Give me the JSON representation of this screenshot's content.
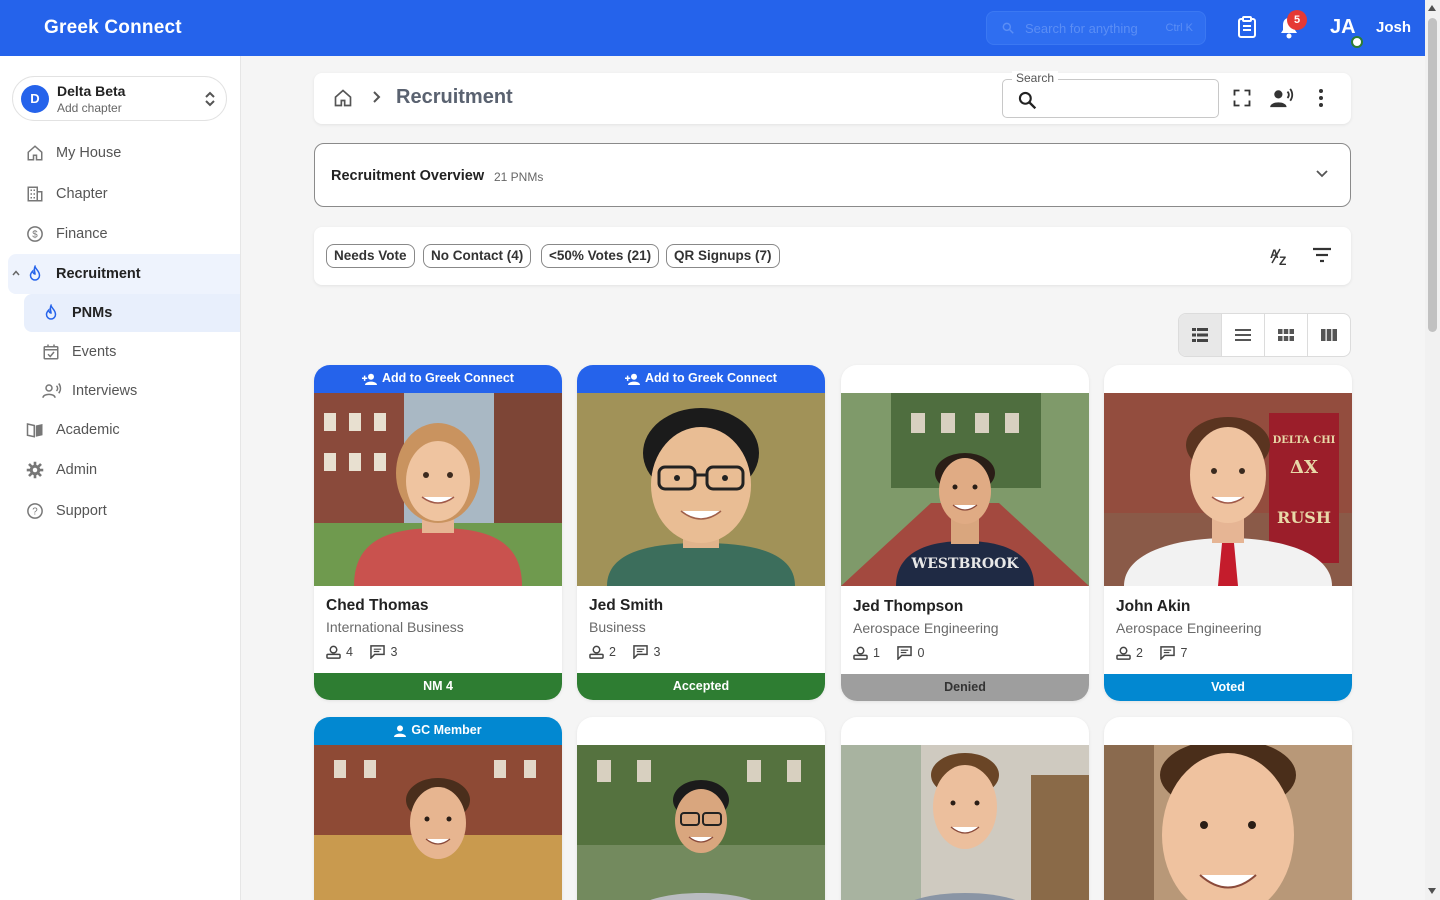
{
  "app": {
    "brand": "Greek Connect"
  },
  "topbar": {
    "search_placeholder": "Search for anything",
    "search_shortcut": "Ctrl K",
    "notification_count": "5",
    "user_initials": "JA",
    "user_name": "Josh"
  },
  "sidebar": {
    "chapter": {
      "initial": "D",
      "name": "Delta Beta",
      "sub": "Add chapter"
    },
    "items": [
      {
        "label": "My House",
        "icon": "home-icon"
      },
      {
        "label": "Chapter",
        "icon": "building-icon"
      },
      {
        "label": "Finance",
        "icon": "dollar-icon"
      },
      {
        "label": "Recruitment",
        "icon": "flame-icon"
      },
      {
        "label": "PNMs",
        "icon": "flame-icon"
      },
      {
        "label": "Events",
        "icon": "calendar-icon"
      },
      {
        "label": "Interviews",
        "icon": "interview-icon"
      },
      {
        "label": "Academic",
        "icon": "book-icon"
      },
      {
        "label": "Admin",
        "icon": "gear-icon"
      },
      {
        "label": "Support",
        "icon": "help-icon"
      }
    ]
  },
  "header": {
    "title": "Recruitment",
    "search_label": "Search",
    "search_value": ""
  },
  "overview": {
    "title": "Recruitment Overview",
    "count": "21 PNMs"
  },
  "filters": {
    "chips": [
      "Needs Vote",
      "No Contact (4)",
      "<50% Votes (21)",
      "QR Signups (7)"
    ]
  },
  "colors": {
    "primary": "#2563eb",
    "nm": "#2e7d32",
    "accepted": "#2e7d32",
    "denied": "#9e9e9e",
    "voted": "#0288d1",
    "gc_member": "#0288d1"
  },
  "cards": [
    {
      "banner": "Add to Greek Connect",
      "name": "Ched Thomas",
      "major": "International Business",
      "votes": "4",
      "comments": "3",
      "status": "NM 4"
    },
    {
      "banner": "Add to Greek Connect",
      "name": "Jed Smith",
      "major": "Business",
      "votes": "2",
      "comments": "3",
      "status": "Accepted"
    },
    {
      "banner": "",
      "name": "Jed Thompson",
      "major": "Aerospace Engineering",
      "votes": "1",
      "comments": "0",
      "status": "Denied"
    },
    {
      "banner": "",
      "name": "John Akin",
      "major": "Aerospace Engineering",
      "votes": "2",
      "comments": "7",
      "status": "Voted"
    },
    {
      "banner": "GC Member"
    },
    {
      "banner": ""
    },
    {
      "banner": ""
    },
    {
      "banner": ""
    }
  ]
}
